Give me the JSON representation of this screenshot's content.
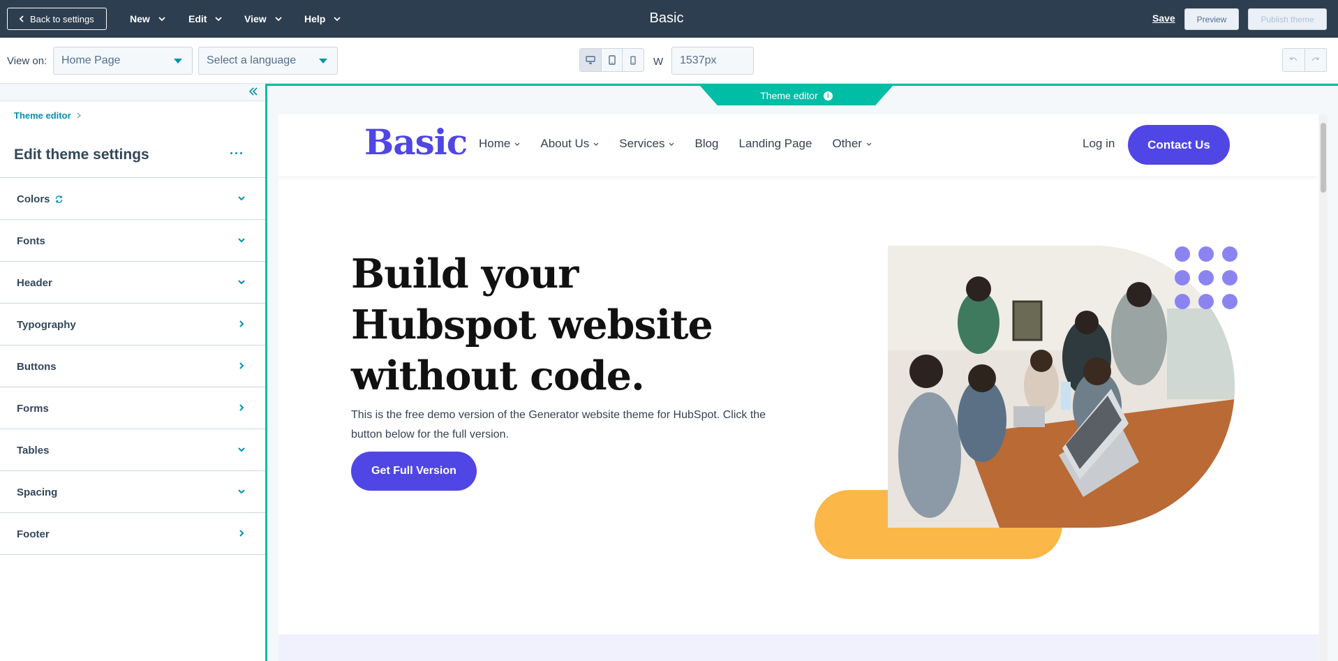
{
  "topbar": {
    "back_label": "Back to settings",
    "menus": [
      "New",
      "Edit",
      "View",
      "Help"
    ],
    "title": "Basic",
    "save_label": "Save",
    "preview_label": "Preview",
    "publish_label": "Publish theme"
  },
  "subbar": {
    "view_on_label": "View on:",
    "page_select": "Home Page",
    "language_select": "Select a language",
    "width_label": "W",
    "width_value": "1537px"
  },
  "sidebar": {
    "breadcrumb": "Theme editor",
    "title": "Edit theme settings",
    "sections": [
      {
        "label": "Colors",
        "expanded": true,
        "refresh_icon": true
      },
      {
        "label": "Fonts",
        "expanded": true
      },
      {
        "label": "Header",
        "expanded": true
      },
      {
        "label": "Typography",
        "expanded": false
      },
      {
        "label": "Buttons",
        "expanded": false
      },
      {
        "label": "Forms",
        "expanded": false
      },
      {
        "label": "Tables",
        "expanded": true
      },
      {
        "label": "Spacing",
        "expanded": true
      },
      {
        "label": "Footer",
        "expanded": false
      }
    ]
  },
  "preview": {
    "tab_label": "Theme editor",
    "site": {
      "logo": "Basic",
      "nav": [
        {
          "label": "Home",
          "dropdown": true
        },
        {
          "label": "About Us",
          "dropdown": true
        },
        {
          "label": "Services",
          "dropdown": true
        },
        {
          "label": "Blog",
          "dropdown": false
        },
        {
          "label": "Landing Page",
          "dropdown": false
        },
        {
          "label": "Other",
          "dropdown": true
        }
      ],
      "login": "Log in",
      "contact": "Contact Us",
      "hero_title": "Build your Hubspot website without code.",
      "hero_text": "This is the free demo version of the Generator website theme for HubSpot. Click the button below for the full version.",
      "hero_button": "Get Full Version"
    }
  },
  "colors": {
    "topbar": "#2d3e50",
    "accent": "#00bda5",
    "link": "#0091ae",
    "brand": "#4f46e5",
    "yellow": "#fbb748",
    "dots": "#8b84f0"
  }
}
